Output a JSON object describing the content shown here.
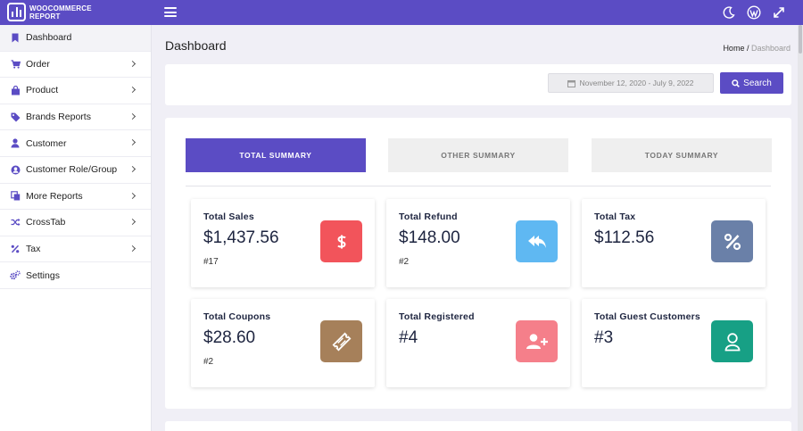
{
  "app": {
    "logo_line1": "WOOCOMMERCE",
    "logo_line2": "REPORT"
  },
  "topbar": {
    "icons": [
      "menu-icon",
      "moon-icon",
      "wordpress-icon",
      "expand-icon"
    ]
  },
  "sidebar": {
    "items": [
      {
        "label": "Dashboard",
        "icon": "bookmark-icon",
        "active": true
      },
      {
        "label": "Order",
        "icon": "cart-icon"
      },
      {
        "label": "Product",
        "icon": "shopping-bag-icon"
      },
      {
        "label": "Brands Reports",
        "icon": "tag-icon"
      },
      {
        "label": "Customer",
        "icon": "user-icon"
      },
      {
        "label": "Customer Role/Group",
        "icon": "user-circle-icon"
      },
      {
        "label": "More Reports",
        "icon": "copy-icon"
      },
      {
        "label": "CrossTab",
        "icon": "shuffle-icon"
      },
      {
        "label": "Tax",
        "icon": "percent-icon"
      },
      {
        "label": "Settings",
        "icon": "cogs-icon"
      }
    ]
  },
  "header": {
    "title": "Dashboard",
    "breadcrumb_home": "Home",
    "breadcrumb_sep": " / ",
    "breadcrumb_current": "Dashboard"
  },
  "filter": {
    "date_range": "November 12, 2020 - July 9, 2022",
    "search_label": "Search"
  },
  "tabs": [
    {
      "label": "TOTAL SUMMARY",
      "active": true
    },
    {
      "label": "OTHER SUMMARY",
      "active": false
    },
    {
      "label": "TODAY SUMMARY",
      "active": false
    }
  ],
  "stats": [
    {
      "title": "Total Sales",
      "value": "$1,437.56",
      "count": "#17",
      "icon": "dollar-icon",
      "color": "#f2545b"
    },
    {
      "title": "Total Refund",
      "value": "$148.00",
      "count": "#2",
      "icon": "reply-all-icon",
      "color": "#5fb8f2"
    },
    {
      "title": "Total Tax",
      "value": "$112.56",
      "count": "",
      "icon": "percent-icon",
      "color": "#6a80a8"
    },
    {
      "title": "Total Coupons",
      "value": "$28.60",
      "count": "#2",
      "icon": "ticket-icon",
      "color": "#a6805a"
    },
    {
      "title": "Total Registered",
      "value": "#4",
      "count": "",
      "icon": "user-plus-icon",
      "color": "#f57f8a"
    },
    {
      "title": "Total Guest Customers",
      "value": "#3",
      "count": "",
      "icon": "user-outline-icon",
      "color": "#17a085"
    }
  ],
  "colors": {
    "brand": "#5b4cc4"
  }
}
